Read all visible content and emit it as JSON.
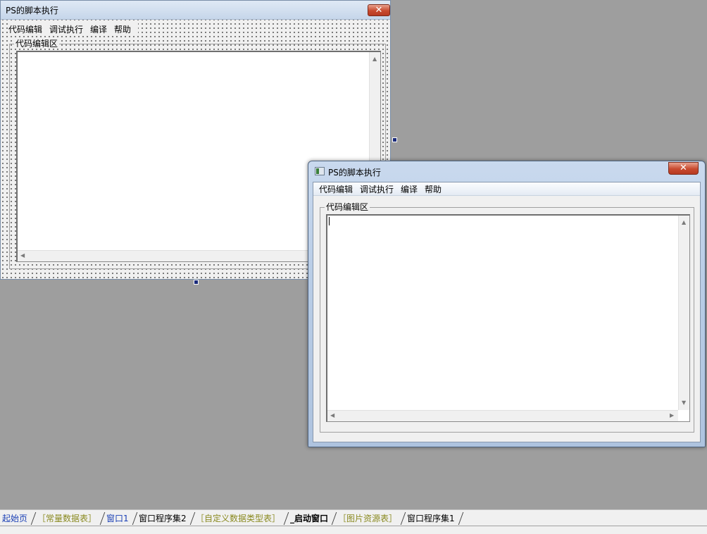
{
  "designer": {
    "title": "PS的脚本执行",
    "close_label": "✕",
    "menu": [
      "代码编辑",
      "调试执行",
      "编译",
      "帮助"
    ],
    "group_label": "代码编辑区",
    "size_label": "",
    "scroll_up": "▲",
    "scroll_left": "◀"
  },
  "preview": {
    "title": "PS的脚本执行",
    "close_label": "✕",
    "menu": [
      "代码编辑",
      "调试执行",
      "编译",
      "帮助"
    ],
    "group_label": "代码编辑区",
    "scroll_up": "▲",
    "scroll_down": "▼",
    "scroll_left": "◀",
    "scroll_right": "▶"
  },
  "tabs": [
    {
      "label": "起始页",
      "style": "blue"
    },
    {
      "label": "［常量数据表］",
      "style": "olive"
    },
    {
      "label": "窗口1",
      "style": "blue"
    },
    {
      "label": "窗口程序集2",
      "style": "plain"
    },
    {
      "label": "［自定义数据类型表］",
      "style": "olive"
    },
    {
      "label": "_启动窗口",
      "style": "active"
    },
    {
      "label": "［图片资源表］",
      "style": "olive"
    },
    {
      "label": "窗口程序集1",
      "style": "plain"
    }
  ],
  "colors": {
    "workspace": "#9e9e9e",
    "selection_handle": "#1a2a7a",
    "close_button": "#c84a2f"
  }
}
